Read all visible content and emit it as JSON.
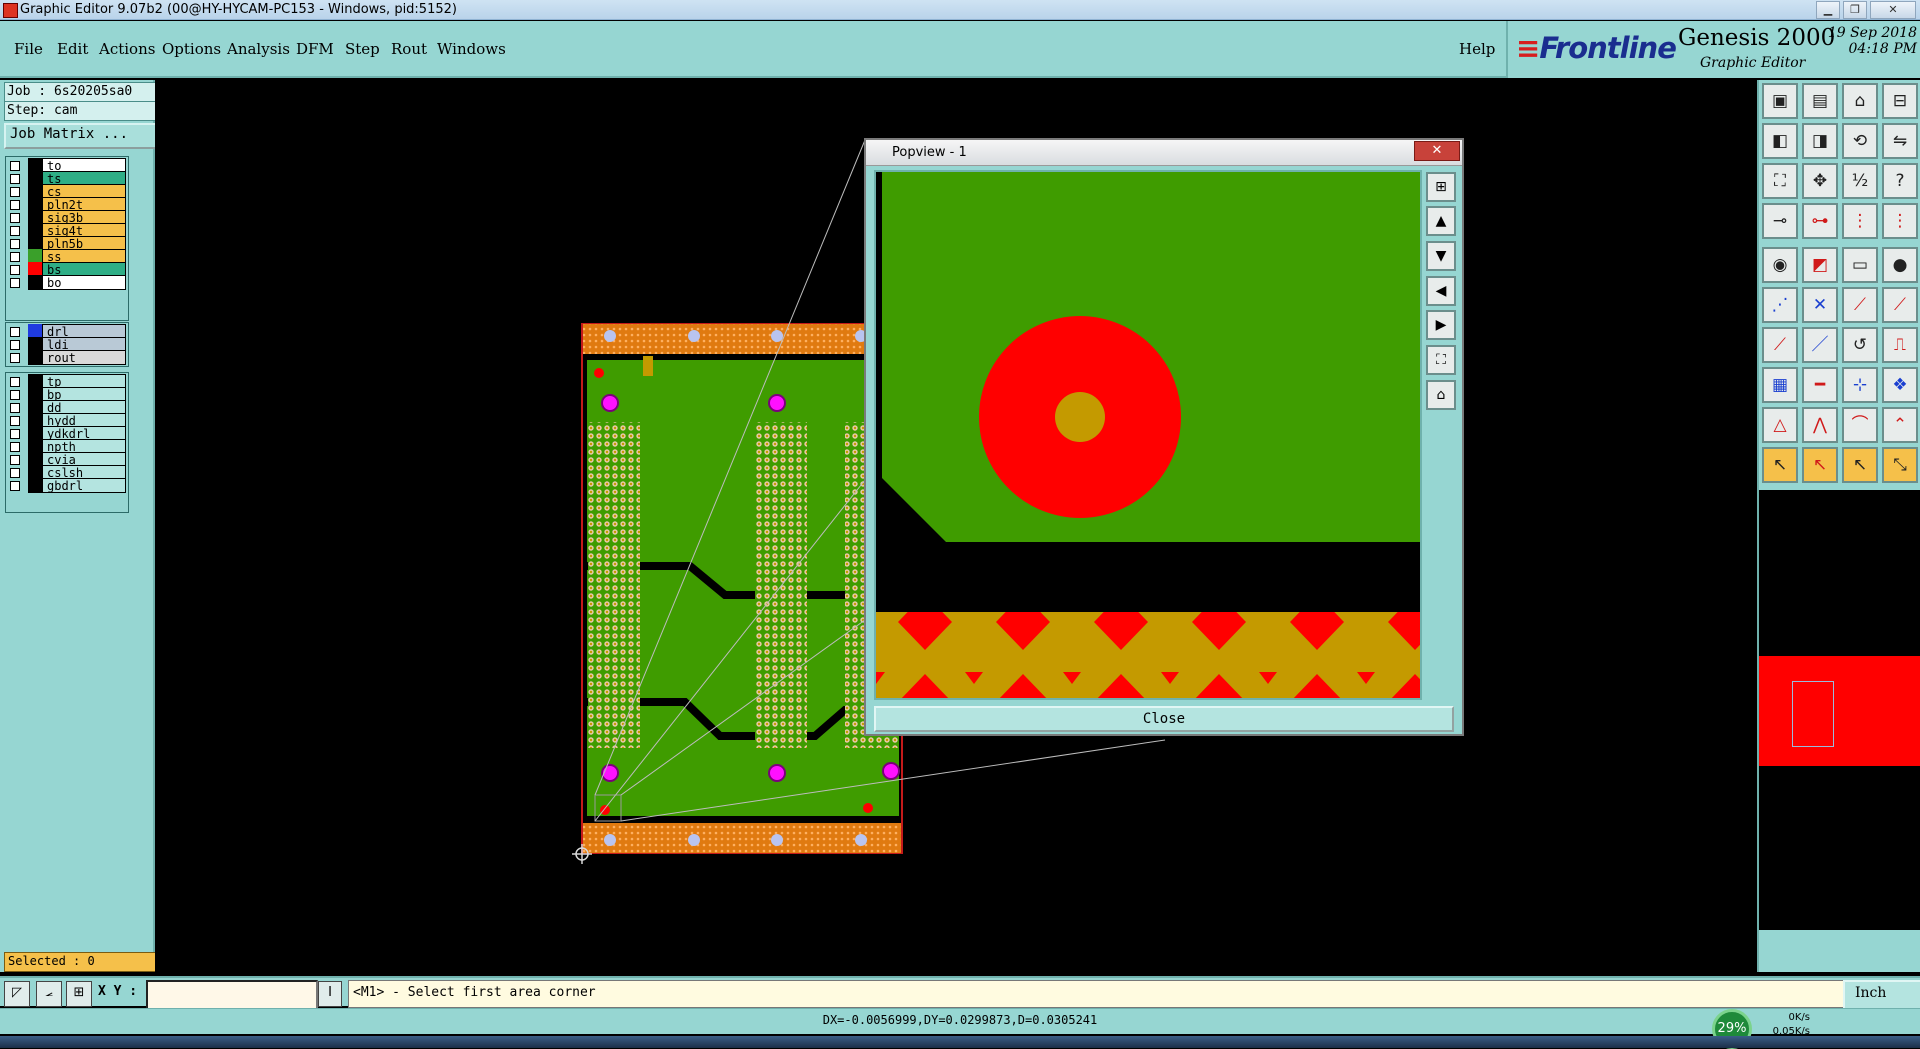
{
  "window": {
    "title": "Graphic Editor 9.07b2 (00@HY-HYCAM-PC153 - Windows, pid:5152)",
    "min_label": "▁",
    "max_label": "❐",
    "close_label": "✕"
  },
  "menu": {
    "items": [
      "File",
      "Edit",
      "Actions",
      "Options",
      "Analysis",
      "DFM",
      "Step",
      "Rout",
      "Windows"
    ],
    "help": "Help"
  },
  "brand": {
    "logo_red": "≡",
    "logo_text": "Frontline",
    "product": "Genesis 2000",
    "subtitle": "Graphic Editor",
    "date": "19 Sep 2018",
    "time": "04:18 PM"
  },
  "left_panel": {
    "job": "Job : 6s20205sa0",
    "step": "Step: cam",
    "job_matrix": "Job Matrix ...",
    "selected": "Selected : 0",
    "board_layers": [
      {
        "name": "to",
        "color": "#ffffff",
        "swatch": "#000000"
      },
      {
        "name": "ts",
        "color": "#2fae86",
        "swatch": "#000000"
      },
      {
        "name": "cs",
        "color": "#f5c04a",
        "swatch": "#000000"
      },
      {
        "name": "pln2t",
        "color": "#f5c04a",
        "swatch": "#000000"
      },
      {
        "name": "sig3b",
        "color": "#f5c04a",
        "swatch": "#000000"
      },
      {
        "name": "sig4t",
        "color": "#f5c04a",
        "swatch": "#000000"
      },
      {
        "name": "pln5b",
        "color": "#f5c04a",
        "swatch": "#000000"
      },
      {
        "name": "ss",
        "color": "#f5c04a",
        "swatch": "#3aa02a"
      },
      {
        "name": "bs",
        "color": "#2fae86",
        "swatch": "#ff0000"
      },
      {
        "name": "bo",
        "color": "#ffffff",
        "swatch": "#000000"
      }
    ],
    "drill_layers": [
      {
        "name": "drl",
        "color": "#b9c9d6",
        "swatch": "#1f3be0"
      },
      {
        "name": "ldi",
        "color": "#b9c9d6",
        "swatch": "#000000"
      },
      {
        "name": "rout",
        "color": "#d9d9d9",
        "swatch": "#000000"
      }
    ],
    "misc_layers": [
      {
        "name": "tp",
        "color": "#b4e4e0",
        "swatch": "#000000"
      },
      {
        "name": "bp",
        "color": "#b4e4e0",
        "swatch": "#000000"
      },
      {
        "name": "dd",
        "color": "#b4e4e0",
        "swatch": "#000000"
      },
      {
        "name": "hydd",
        "color": "#b4e4e0",
        "swatch": "#000000"
      },
      {
        "name": "ydkdrl",
        "color": "#b4e4e0",
        "swatch": "#000000"
      },
      {
        "name": "npth",
        "color": "#b4e4e0",
        "swatch": "#000000"
      },
      {
        "name": "cvia",
        "color": "#b4e4e0",
        "swatch": "#000000"
      },
      {
        "name": "cslsh",
        "color": "#b4e4e0",
        "swatch": "#000000"
      },
      {
        "name": "gbdrl",
        "color": "#b4e4e0",
        "swatch": "#000000"
      }
    ]
  },
  "popview": {
    "title": "Popview - 1",
    "close_x": "✕",
    "close_button": "Close"
  },
  "command_bar": {
    "xy_label": "X Y :",
    "xy_value": "",
    "prompt": "<M1> - Select first area corner",
    "units": "Inch"
  },
  "measure": {
    "text": "DX=-0.0056999,DY=0.0299873,D=0.0305241"
  },
  "network": {
    "percent": "29%",
    "up": "0K/s",
    "down": "0.05K/s"
  },
  "colors": {
    "panel": "#96d6d2",
    "copper_green": "#3f9c00",
    "pad_red": "#ff0000",
    "gold": "#c49a00",
    "magenta": "#ff00ff"
  }
}
